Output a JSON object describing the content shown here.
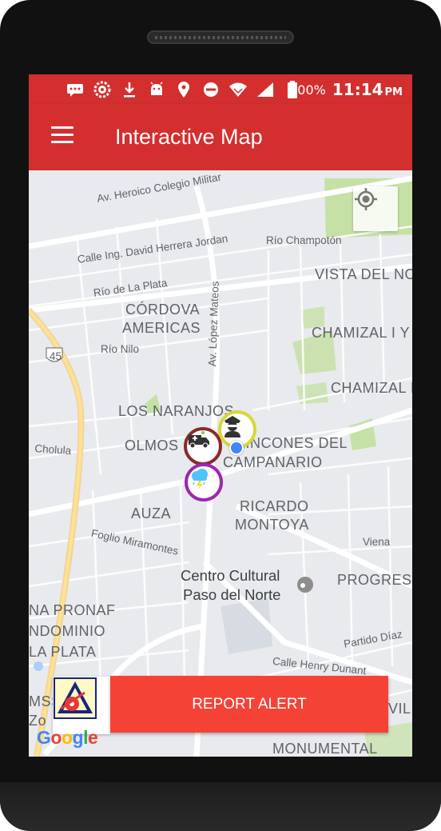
{
  "status_bar": {
    "battery_percent": "100%",
    "time": "11:14",
    "ampm": "PM",
    "icons": [
      "message-icon",
      "settings-gear-icon",
      "download-icon",
      "android-icon",
      "location-pin-icon",
      "do-not-disturb-icon",
      "wifi-icon",
      "signal-icon",
      "battery-icon"
    ]
  },
  "app_bar": {
    "title": "Interactive Map",
    "menu_icon": "hamburger-menu-icon"
  },
  "map": {
    "streets": [
      "Av. Heroico Colegio Militar",
      "Calle Ing. David Herrera Jordan",
      "Río Champotón",
      "Río de La Plata",
      "Av. López Mateos",
      "Río Nilo",
      "Cholula",
      "Foglio Miramontes",
      "Partido Díaz",
      "Calle Henry Dunant",
      "Viena"
    ],
    "highway_shield": "45",
    "neighborhoods": [
      "VISTA DEL NO",
      "CÓRDOVA",
      "AMERICAS",
      "CHAMIZAL I Y",
      "CHAMIZAL I",
      "LOS NARANJOS",
      "OLMOS",
      "RINCONES DEL",
      "CAMPANARIO",
      "AUZA",
      "RICARDO",
      "MONTOYA",
      "PROGRESIS",
      "NA PRONAF",
      "NDOMINIO",
      "LA PLATA",
      "MSS",
      "Zo",
      "VIL",
      "MONUMENTAL"
    ],
    "poi": {
      "line1": "Centro Cultural",
      "line2": "Paso del Norte"
    },
    "google_logo": "Google",
    "locate_icon": "my-location-crosshair-icon",
    "markers": [
      {
        "name": "ambulance-alert-marker",
        "icon": "ambulance-icon",
        "ring_color": "#8b2a2a"
      },
      {
        "name": "police-alert-marker",
        "icon": "police-officer-icon",
        "ring_color": "#d8d63a"
      },
      {
        "name": "storm-alert-marker",
        "icon": "storm-cloud-icon",
        "ring_color": "#9c27b0"
      }
    ],
    "user_location_color": "#4285f4"
  },
  "report": {
    "button_label": "REPORT ALERT",
    "logo_icon": "app-logo-icon"
  },
  "colors": {
    "primary": "#d32f2f",
    "accent_button": "#f44336",
    "map_bg": "#e8eaed",
    "park": "#c5e1a5"
  }
}
